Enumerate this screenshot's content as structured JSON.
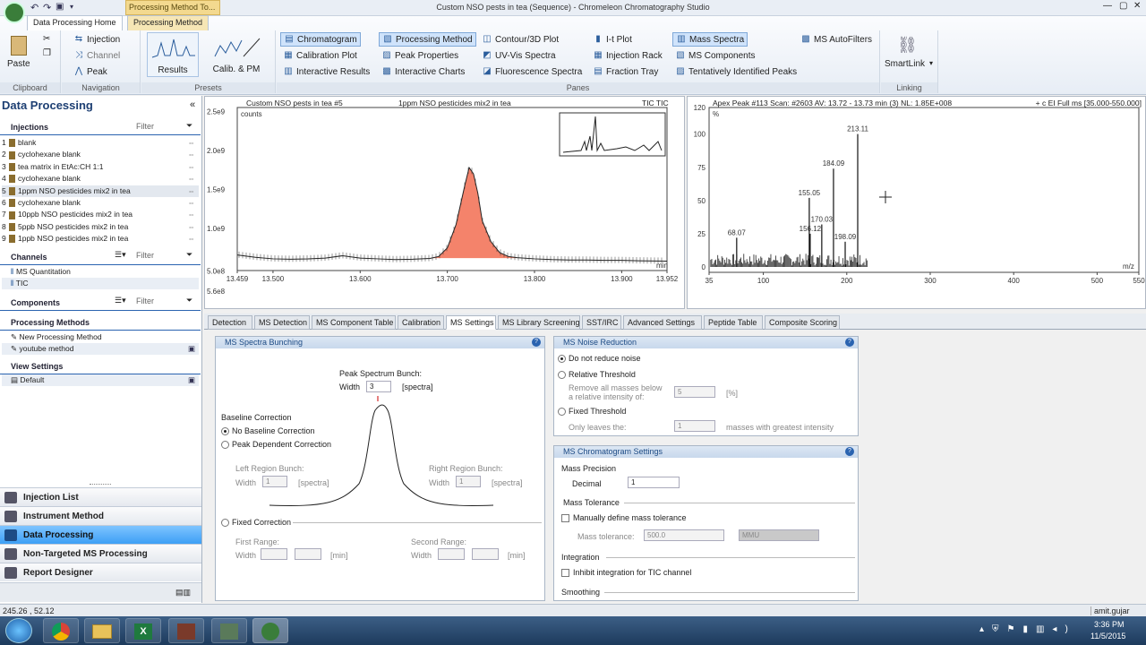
{
  "window": {
    "title": "Custom NSO pests in tea (Sequence) - Chromeleon Chromatography Studio",
    "tabs": [
      "Data Processing Home",
      "Processing Method",
      "Processing Method To..."
    ]
  },
  "ribbon": {
    "clipboard": {
      "label": "Clipboard",
      "paste": "Paste"
    },
    "navigation": {
      "label": "Navigation",
      "items": [
        "Injection",
        "Channel",
        "Peak"
      ]
    },
    "presets": {
      "label": "Presets",
      "results": "Results",
      "calib": "Calib. & PM"
    },
    "panes": {
      "label": "Panes",
      "col1": [
        "Chromatogram",
        "Calibration Plot",
        "Interactive Results"
      ],
      "col2": [
        "Processing Method",
        "Peak Properties",
        "Interactive Charts"
      ],
      "col3": [
        "Contour/3D Plot",
        "UV-Vis Spectra",
        "Fluorescence Spectra"
      ],
      "col4": [
        "I-t Plot",
        "Injection Rack",
        "Fraction Tray"
      ],
      "col5": [
        "Mass Spectra",
        "MS Components",
        "Tentatively Identified Peaks"
      ],
      "col6": [
        "MS AutoFilters"
      ]
    },
    "linking": {
      "label": "Linking",
      "smartlink": "SmartLink"
    }
  },
  "left": {
    "title": "Data Processing",
    "filter": "Filter",
    "injections_label": "Injections",
    "injections": [
      {
        "num": "1",
        "name": "blank"
      },
      {
        "num": "2",
        "name": "cyclohexane blank"
      },
      {
        "num": "3",
        "name": "tea matrix in EtAc:CH 1:1"
      },
      {
        "num": "4",
        "name": "cyclohexane blank"
      },
      {
        "num": "5",
        "name": "1ppm NSO pesticides mix2 in tea"
      },
      {
        "num": "6",
        "name": "cyclohexane blank"
      },
      {
        "num": "7",
        "name": "10ppb NSO pesticides mix2 in tea"
      },
      {
        "num": "8",
        "name": "5ppb NSO pesticides mix2 in tea"
      },
      {
        "num": "9",
        "name": "1ppb NSO pesticides mix2 in tea"
      }
    ],
    "channels_label": "Channels",
    "channels": [
      "MS Quantitation",
      "TIC"
    ],
    "components_label": "Components",
    "processing_methods_label": "Processing Methods",
    "processing_methods": [
      "New Processing Method",
      "youtube method"
    ],
    "view_settings_label": "View Settings",
    "view_settings": [
      "Default"
    ],
    "nav": [
      "Injection List",
      "Instrument Method",
      "Data Processing",
      "Non-Targeted MS Processing",
      "Report Designer"
    ]
  },
  "chromatogram": {
    "header_left": "Custom NSO pests in tea #5",
    "header_mid": "1ppm NSO pesticides mix2 in tea",
    "header_right": "TIC TIC",
    "unit_label": "counts",
    "min_label": "min"
  },
  "chart_data": [
    {
      "type": "line",
      "title": "",
      "xlabel": "min",
      "ylabel": "counts",
      "xlim": [
        13.459,
        13.952
      ],
      "ylim": [
        560000000.0,
        2500000000.0
      ],
      "x_ticks": [
        "13.459",
        "13.500",
        "13.600",
        "13.700",
        "13.800",
        "13.900",
        "13.952"
      ],
      "y_ticks": [
        "5.6e8",
        "5.0e8",
        "1.0e9",
        "1.5e9",
        "2.0e9",
        "2.5e9"
      ],
      "series": [
        {
          "x": [
            13.459,
            13.48,
            13.5,
            13.52,
            13.54,
            13.56,
            13.58,
            13.6,
            13.62,
            13.64,
            13.66,
            13.68,
            13.69,
            13.7,
            13.71,
            13.72,
            13.725,
            13.73,
            13.735,
            13.74,
            13.75,
            13.76,
            13.77,
            13.78,
            13.8,
            13.82,
            13.84,
            13.86,
            13.88,
            13.9,
            13.92,
            13.952
          ],
          "y": [
            660000000.0,
            630000000.0,
            610000000.0,
            605000000.0,
            610000000.0,
            620000000.0,
            650000000.0,
            620000000.0,
            610000000.0,
            600000000.0,
            605000000.0,
            615000000.0,
            640000000.0,
            750000000.0,
            1050000000.0,
            1550000000.0,
            1780000000.0,
            1700000000.0,
            1450000000.0,
            1100000000.0,
            830000000.0,
            690000000.0,
            640000000.0,
            625000000.0,
            610000000.0,
            600000000.0,
            595000000.0,
            595000000.0,
            590000000.0,
            590000000.0,
            585000000.0,
            580000000.0
          ]
        }
      ]
    },
    {
      "type": "bar",
      "title": "",
      "xlabel": "m/z",
      "ylabel": "%",
      "xlim": [
        35,
        550
      ],
      "ylim": [
        0,
        120
      ],
      "x_ticks": [
        "35",
        "100",
        "200",
        "300",
        "400",
        "500",
        "550"
      ],
      "y_ticks": [
        "0",
        "25",
        "50",
        "75",
        "100",
        "120"
      ],
      "peaks": [
        {
          "x": 68.07,
          "y": 22,
          "label": "68.07"
        },
        {
          "x": 155.05,
          "y": 52,
          "label": "155.05"
        },
        {
          "x": 156.12,
          "y": 25,
          "label": "156.12"
        },
        {
          "x": 170.03,
          "y": 32,
          "label": "170.03"
        },
        {
          "x": 184.09,
          "y": 74,
          "label": "184.09"
        },
        {
          "x": 198.09,
          "y": 19,
          "label": "198.09"
        },
        {
          "x": 213.11,
          "y": 100,
          "label": "213.11"
        }
      ]
    }
  ],
  "mass_spectrum": {
    "header_left": "Apex Peak #113 Scan: #2603  AV: 13.72 - 13.73 min (3) NL: 1.85E+008",
    "header_right": "+ c EI Full ms [35.000-550.000]",
    "unit_label": "%",
    "mz_label": "m/z"
  },
  "settings_tabs": [
    "Detection",
    "MS Detection",
    "MS Component Table",
    "Calibration",
    "MS Settings",
    "MS Library Screening",
    "SST/IRC",
    "Advanced Settings",
    "Peptide Table",
    "Composite Scoring"
  ],
  "spectra_bunching": {
    "title": "MS Spectra Bunching",
    "peak_spectrum_bunch": "Peak Spectrum Bunch:",
    "width_label": "Width",
    "width_value": "3",
    "spectra_unit": "[spectra]",
    "baseline_correction": "Baseline Correction",
    "no_baseline": "No Baseline Correction",
    "peak_dependent": "Peak Dependent Correction",
    "left_region": "Left Region Bunch:",
    "right_region": "Right Region Bunch:",
    "left_width": "1",
    "right_width": "1",
    "fixed_correction": "Fixed Correction",
    "first_range": "First Range:",
    "second_range": "Second Range:",
    "min_unit": "[min]"
  },
  "noise_reduction": {
    "title": "MS Noise Reduction",
    "do_not_reduce": "Do not reduce noise",
    "relative_threshold": "Relative Threshold",
    "remove_text1": "Remove all masses below",
    "remove_text2": "a relative intensity of:",
    "relative_value": "5",
    "percent": "[%]",
    "fixed_threshold": "Fixed Threshold",
    "only_leaves": "Only leaves the:",
    "leaves_value": "1",
    "masses_greatest": "masses with greatest intensity"
  },
  "chrom_settings": {
    "title": "MS Chromatogram Settings",
    "mass_precision": "Mass Precision",
    "decimal_label": "Decimal",
    "decimal_value": "1",
    "mass_tolerance": "Mass Tolerance",
    "manually_define": "Manually define mass tolerance",
    "tolerance_label": "Mass tolerance:",
    "tolerance_value": "500.0",
    "tolerance_unit": "MMU",
    "integration": "Integration",
    "inhibit": "Inhibit integration for TIC channel",
    "smoothing": "Smoothing"
  },
  "status": {
    "coords": "245.26 , 52.12",
    "user": "amit.gujar"
  },
  "taskbar": {
    "time": "3:36 PM",
    "date": "11/5/2015"
  },
  "colors": {
    "accent": "#3d9ff5",
    "peak_fill": "#f4836b",
    "header_blue": "#1d4b85"
  }
}
